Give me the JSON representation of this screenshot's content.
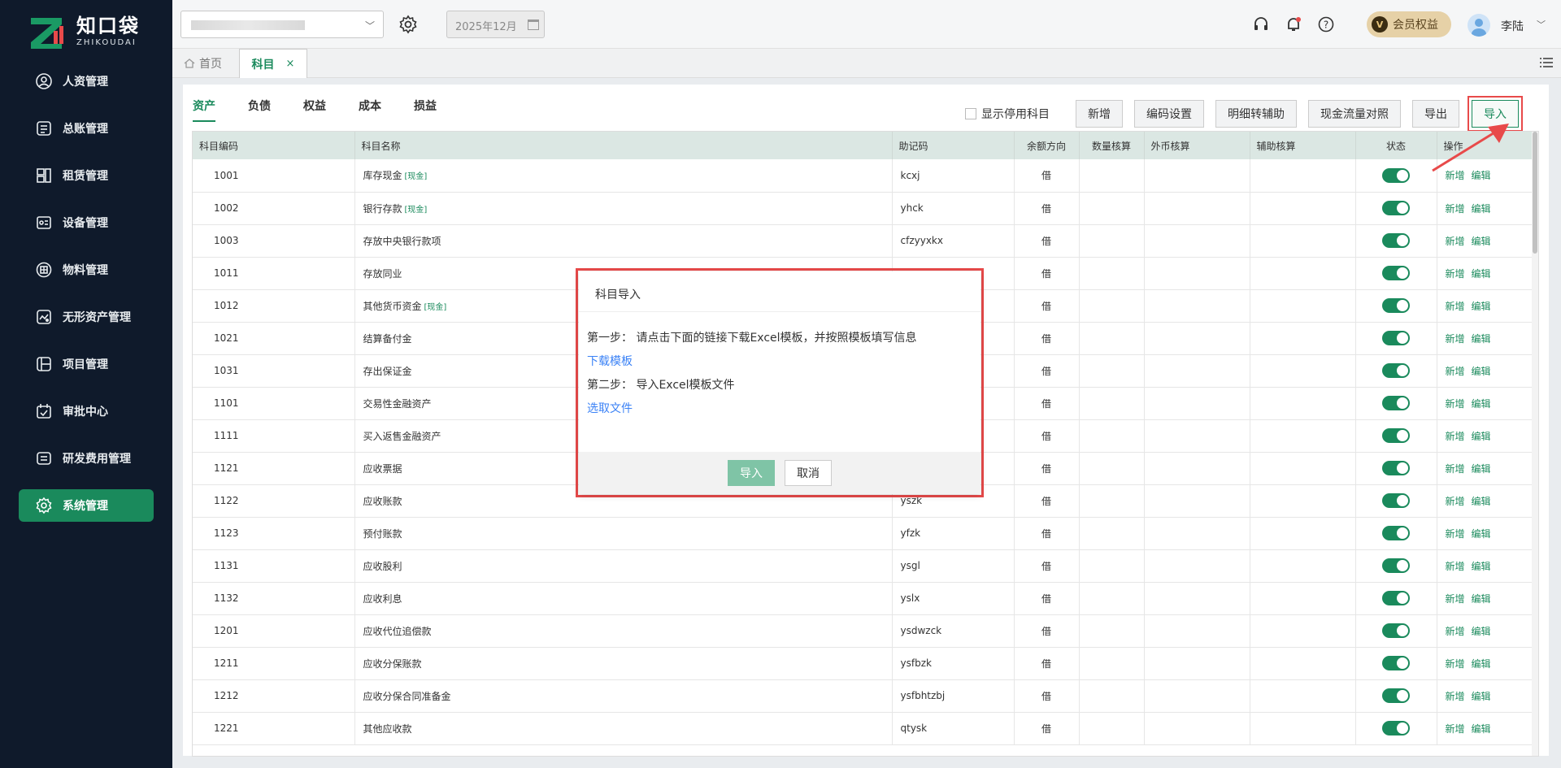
{
  "brand": {
    "name_cn": "知口袋",
    "name_en": "ZHIKOUDAI"
  },
  "sidebar": {
    "items": [
      {
        "label": "人资管理",
        "icon": "user-circle-icon",
        "active": false
      },
      {
        "label": "总账管理",
        "icon": "ledger-icon",
        "active": false
      },
      {
        "label": "租赁管理",
        "icon": "lease-icon",
        "active": false
      },
      {
        "label": "设备管理",
        "icon": "device-icon",
        "active": false
      },
      {
        "label": "物料管理",
        "icon": "material-icon",
        "active": false
      },
      {
        "label": "无形资产管理",
        "icon": "intangible-asset-icon",
        "active": false
      },
      {
        "label": "项目管理",
        "icon": "project-icon",
        "active": false
      },
      {
        "label": "审批中心",
        "icon": "approval-icon",
        "active": false
      },
      {
        "label": "研发费用管理",
        "icon": "rd-expense-icon",
        "active": false
      },
      {
        "label": "系统管理",
        "icon": "gear-icon",
        "active": true
      }
    ]
  },
  "header": {
    "period": "2025年12月",
    "vip_label": "会员权益",
    "vip_badge": "V",
    "username": "李陆"
  },
  "tabs": {
    "home": "首页",
    "active": "科目",
    "close": "×"
  },
  "categories": [
    "资产",
    "负债",
    "权益",
    "成本",
    "损益"
  ],
  "toolbar": {
    "show_disabled": "显示停用科目",
    "buttons": [
      "新增",
      "编码设置",
      "明细转辅助",
      "现金流量对照",
      "导出"
    ],
    "import": "导入"
  },
  "table": {
    "columns": [
      "科目编码",
      "科目名称",
      "助记码",
      "余额方向",
      "数量核算",
      "外币核算",
      "辅助核算",
      "状态",
      "操作"
    ],
    "cash_tag": "[现金]",
    "op_add": "新增",
    "op_edit": "编辑",
    "rows": [
      {
        "code": "1001",
        "name": "库存现金",
        "cash": true,
        "mnemonic": "kcxj",
        "dir": "借"
      },
      {
        "code": "1002",
        "name": "银行存款",
        "cash": true,
        "mnemonic": "yhck",
        "dir": "借"
      },
      {
        "code": "1003",
        "name": "存放中央银行款项",
        "cash": false,
        "mnemonic": "cfzyyxkx",
        "dir": "借"
      },
      {
        "code": "1011",
        "name": "存放同业",
        "cash": false,
        "mnemonic": "",
        "dir": "借"
      },
      {
        "code": "1012",
        "name": "其他货币资金",
        "cash": true,
        "mnemonic": "",
        "dir": "借"
      },
      {
        "code": "1021",
        "name": "结算备付金",
        "cash": false,
        "mnemonic": "",
        "dir": "借"
      },
      {
        "code": "1031",
        "name": "存出保证金",
        "cash": false,
        "mnemonic": "",
        "dir": "借"
      },
      {
        "code": "1101",
        "name": "交易性金融资产",
        "cash": false,
        "mnemonic": "",
        "dir": "借"
      },
      {
        "code": "1111",
        "name": "买入返售金融资产",
        "cash": false,
        "mnemonic": "",
        "dir": "借"
      },
      {
        "code": "1121",
        "name": "应收票据",
        "cash": false,
        "mnemonic": "",
        "dir": "借"
      },
      {
        "code": "1122",
        "name": "应收账款",
        "cash": false,
        "mnemonic": "yszk",
        "dir": "借"
      },
      {
        "code": "1123",
        "name": "预付账款",
        "cash": false,
        "mnemonic": "yfzk",
        "dir": "借"
      },
      {
        "code": "1131",
        "name": "应收股利",
        "cash": false,
        "mnemonic": "ysgl",
        "dir": "借"
      },
      {
        "code": "1132",
        "name": "应收利息",
        "cash": false,
        "mnemonic": "yslx",
        "dir": "借"
      },
      {
        "code": "1201",
        "name": "应收代位追偿款",
        "cash": false,
        "mnemonic": "ysdwzck",
        "dir": "借"
      },
      {
        "code": "1211",
        "name": "应收分保账款",
        "cash": false,
        "mnemonic": "ysfbzk",
        "dir": "借"
      },
      {
        "code": "1212",
        "name": "应收分保合同准备金",
        "cash": false,
        "mnemonic": "ysfbhtzbj",
        "dir": "借"
      },
      {
        "code": "1221",
        "name": "其他应收款",
        "cash": false,
        "mnemonic": "qtysk",
        "dir": "借"
      }
    ]
  },
  "modal": {
    "title": "科目导入",
    "step1": "第一步： 请点击下面的链接下载Excel模板，并按照模板填写信息",
    "download_link": "下载模板",
    "step2": "第二步： 导入Excel模板文件",
    "select_link": "选取文件",
    "confirm": "导入",
    "cancel": "取消"
  },
  "colors": {
    "accent": "#1a8a5c",
    "sidebar_bg": "#0f1a2b",
    "highlight": "#e84a4a"
  }
}
